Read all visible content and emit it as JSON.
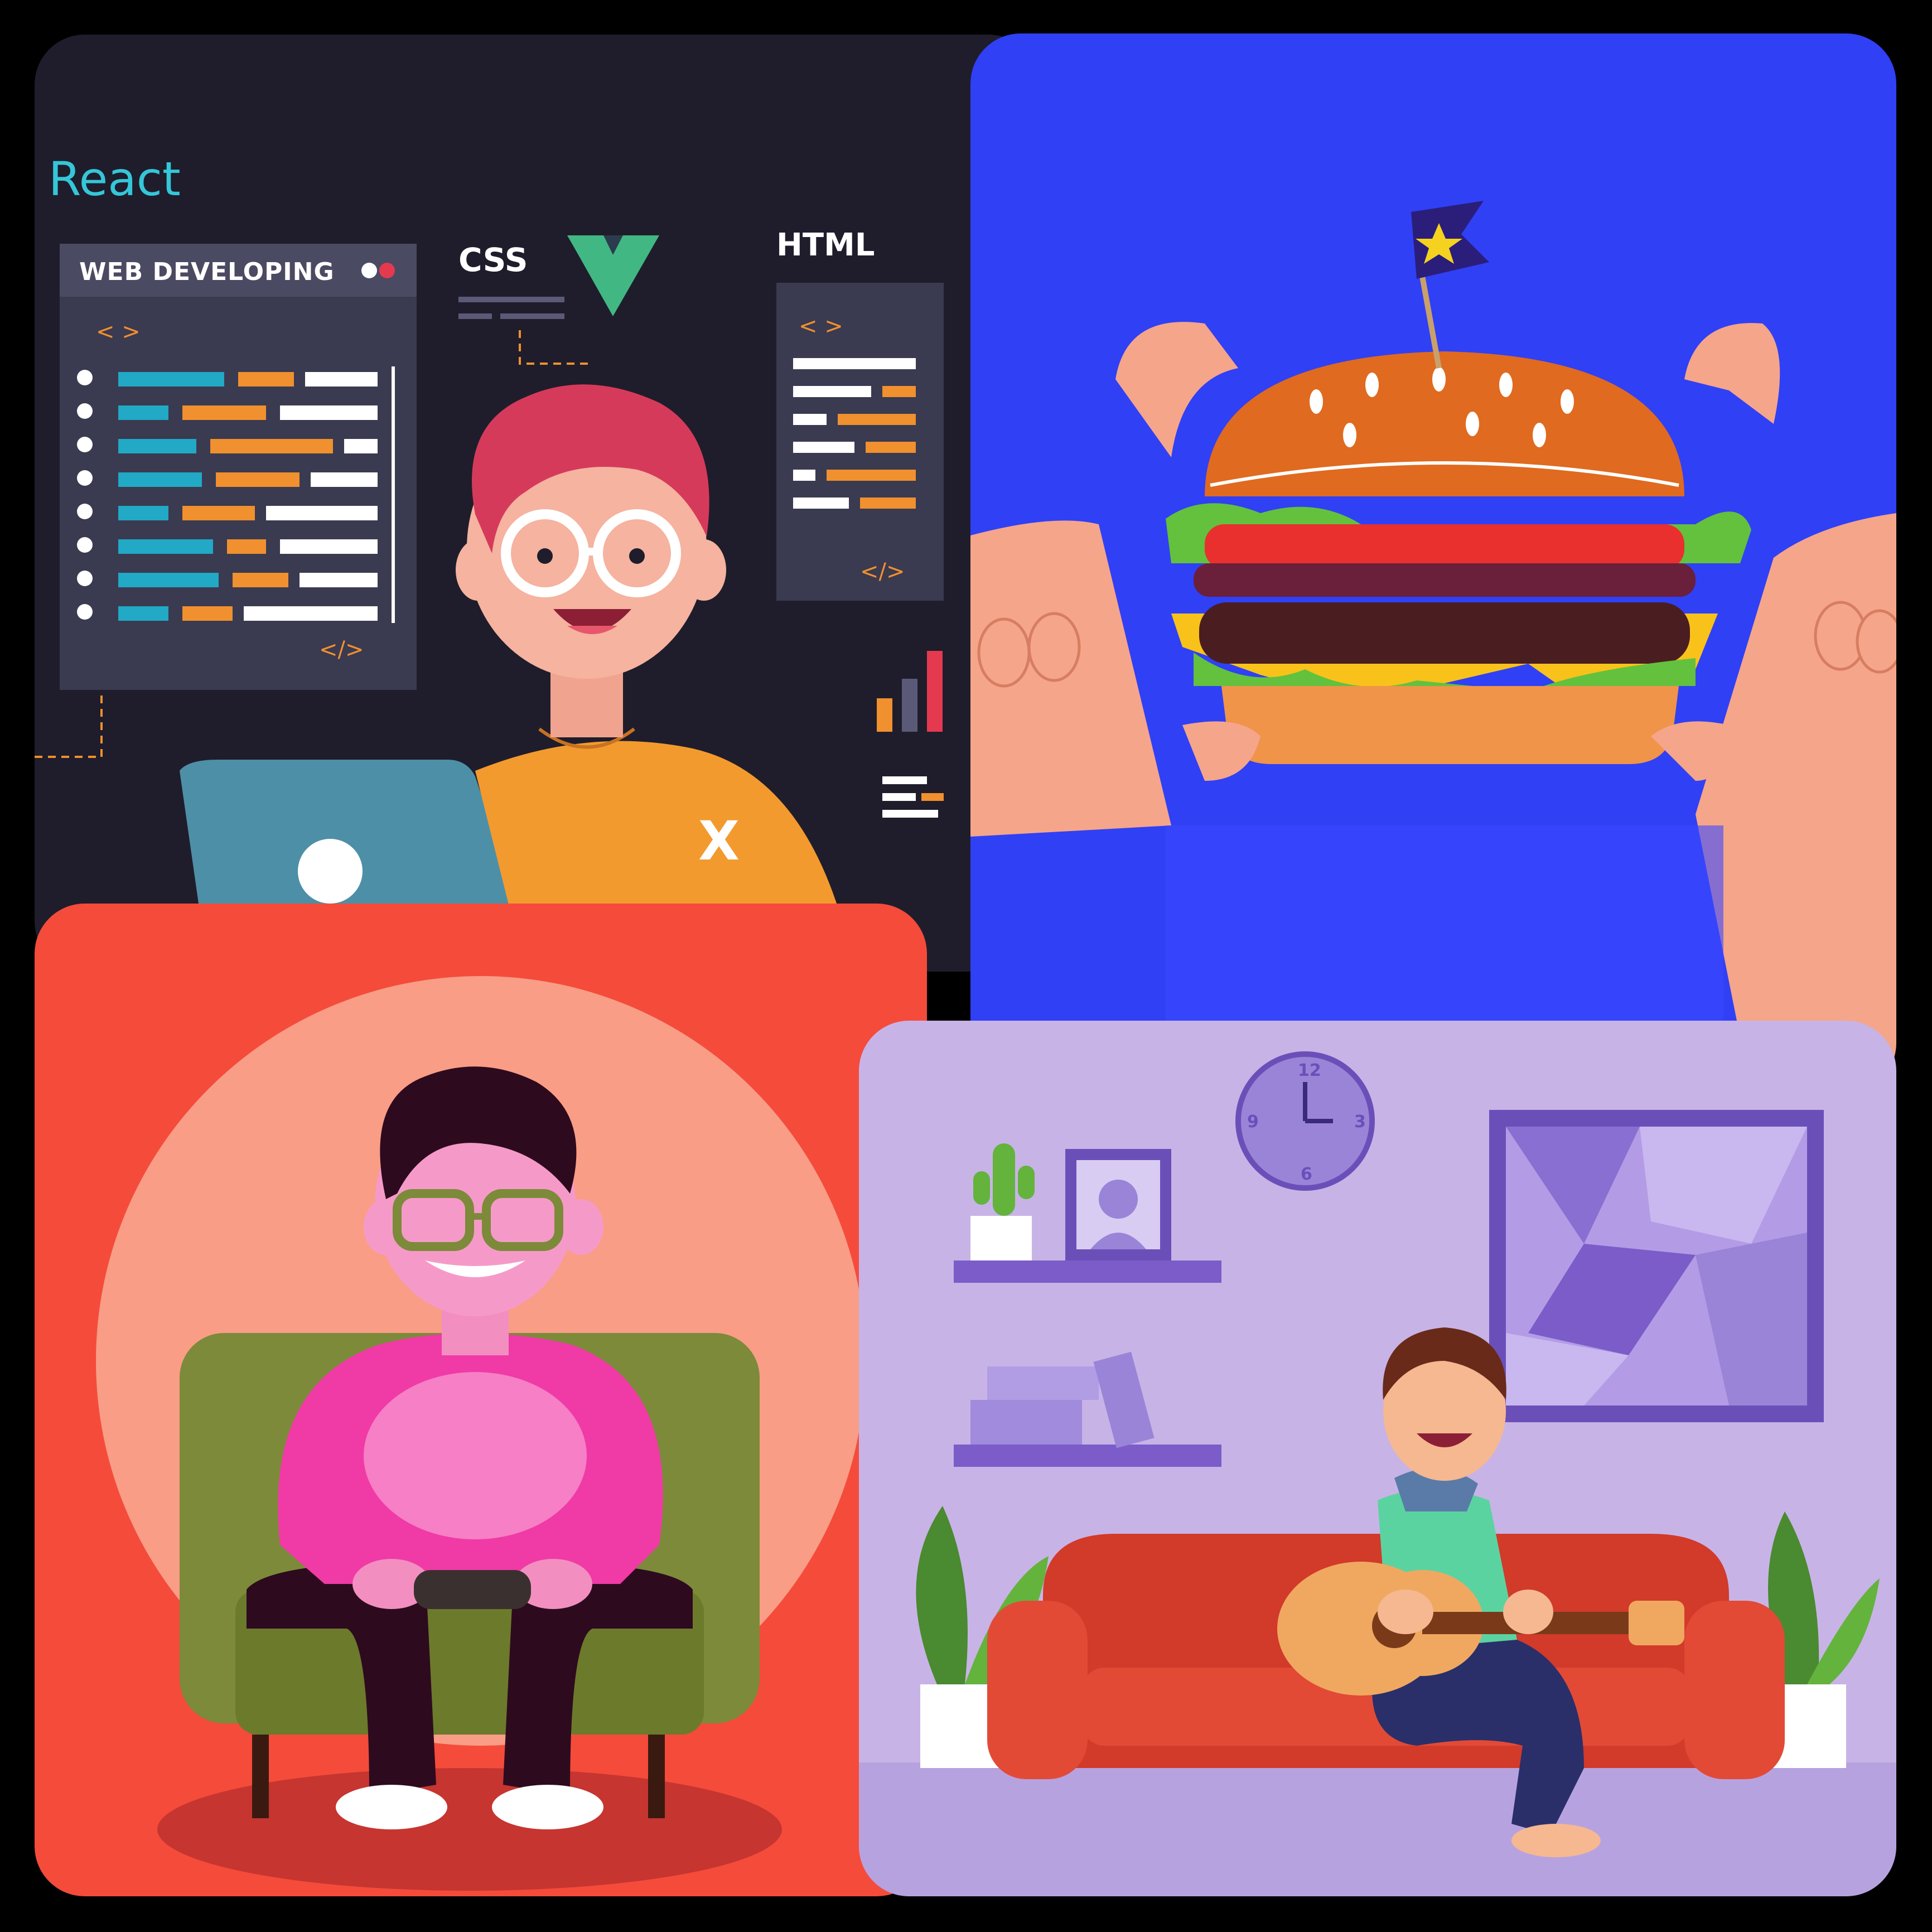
{
  "collage": {
    "dev_panel": {
      "react_label": "React",
      "css_label": "CSS",
      "html_label": "HTML",
      "window_title": "WEB DEVELOPING",
      "tag_open": "< >",
      "tag_close": "</>",
      "shirt_letter": "X"
    },
    "guitar_panel": {
      "clock_12": "12",
      "clock_3": "3",
      "clock_6": "6",
      "clock_9": "9"
    }
  },
  "colors": {
    "dev_bg": "#1f1d2b",
    "burger_bg": "#3040f5",
    "gamer_bg": "#f54b3b",
    "guitar_bg": "#c8b3e6"
  }
}
